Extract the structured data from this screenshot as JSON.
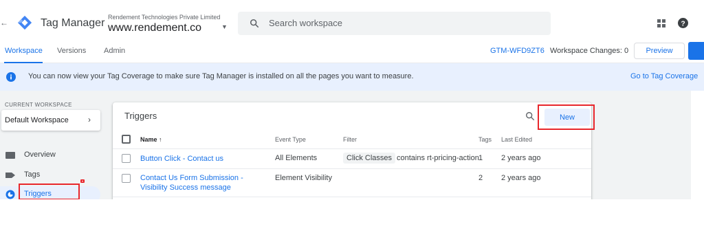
{
  "header": {
    "back_arrow": "←",
    "product_name": "Tag Manager",
    "account_name": "Rendement Technologies Private Limited",
    "container_name": "www.rendement.co",
    "container_caret": "▼",
    "search_placeholder": "Search workspace",
    "icons": [
      "back-arrow-icon",
      "tag-manager-logo",
      "search-icon",
      "apps-icon",
      "help-icon"
    ]
  },
  "nav": {
    "tabs": [
      {
        "label": "Workspace",
        "active": true
      },
      {
        "label": "Versions",
        "active": false
      },
      {
        "label": "Admin",
        "active": false
      }
    ],
    "container_id": "GTM-WFD9ZT6",
    "workspace_changes": "Workspace Changes: 0",
    "preview_label": "Preview"
  },
  "banner": {
    "text": "You can now view your Tag Coverage to make sure Tag Manager is installed on all the pages you want to measure.",
    "link": "Go to Tag Coverage"
  },
  "sidebar": {
    "heading": "CURRENT WORKSPACE",
    "workspace": "Default Workspace",
    "workspace_chevron": "›",
    "items": [
      {
        "label": "Overview",
        "icon": "overview-icon",
        "active": false
      },
      {
        "label": "Tags",
        "icon": "tag-icon",
        "active": false
      },
      {
        "label": "Triggers",
        "icon": "trigger-icon",
        "active": true
      }
    ]
  },
  "triggers": {
    "title": "Triggers",
    "new_label": "New",
    "columns": [
      "Name ↑",
      "Event Type",
      "Filter",
      "Tags",
      "Last Edited"
    ],
    "rows": [
      {
        "name": "Button Click - Contact us",
        "event_type": "All Elements",
        "filter_chip": "Click Classes",
        "filter_rest": "contains rt-pricing-action",
        "tags": "1",
        "last_edited": "2 years ago"
      },
      {
        "name": "Contact Us Form Submission - Visibility Success message",
        "event_type": "Element Visibility",
        "filter_chip": "",
        "filter_rest": "",
        "tags": "2",
        "last_edited": "2 years ago"
      }
    ]
  },
  "colors": {
    "accent": "#1a73e8",
    "highlight_red": "#e8262b",
    "banner_bg": "#e8f0fe",
    "page_bg": "#f1f3f4"
  }
}
